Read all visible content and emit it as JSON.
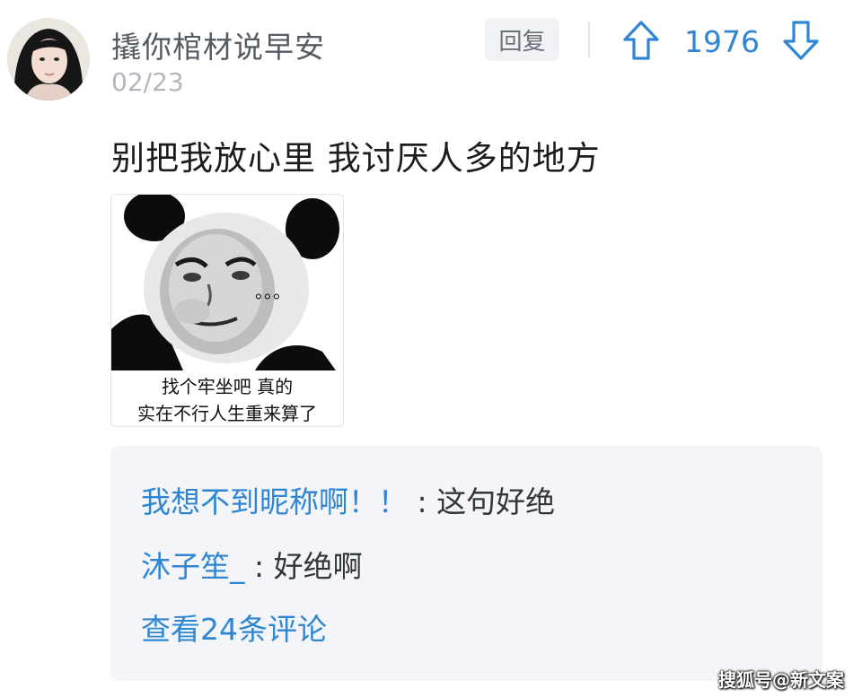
{
  "post": {
    "username": "撬你棺材说早安",
    "date": "02/23",
    "reply_label": "回复",
    "vote_count": "1976",
    "text": "别把我放心里 我讨厌人多的地方",
    "meme": {
      "dots": "。。。",
      "caption_line1": "找个牢坐吧   真的",
      "caption_line2": "实在不行人生重来算了"
    }
  },
  "comments": [
    {
      "user": "我想不到昵称啊！！",
      "text": " : 这句好绝"
    },
    {
      "user": "沐子笙_",
      "text": " : 好绝啊"
    }
  ],
  "view_more": "查看24条评论",
  "watermark": "搜狐号@新文案",
  "colors": {
    "accent": "#2f86d4",
    "username": "#555b63",
    "date": "#b3b7bd",
    "comment_bg": "#f4f5f8"
  },
  "icons": {
    "upvote": "arrow-up-outline-icon",
    "downvote": "arrow-down-outline-icon"
  }
}
